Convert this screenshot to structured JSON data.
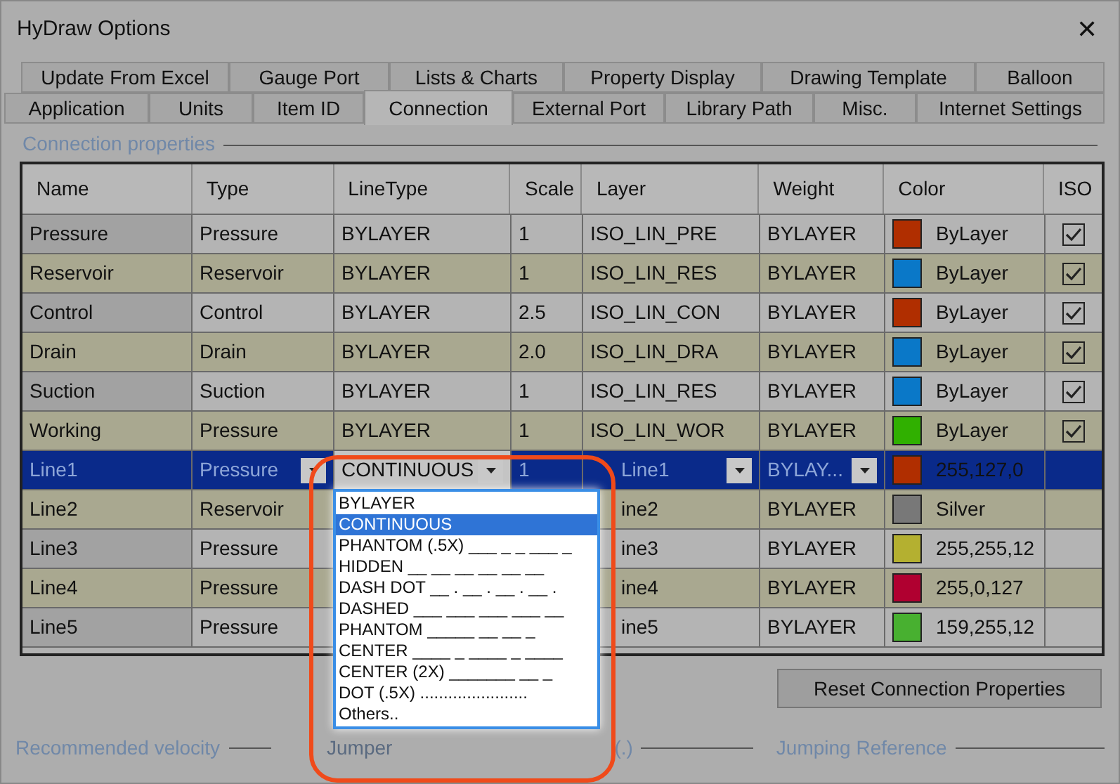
{
  "window": {
    "title": "HyDraw Options",
    "close": "✕"
  },
  "tab_rows": [
    [
      {
        "label": "Update From Excel",
        "selected": false
      },
      {
        "label": "Gauge Port",
        "selected": false
      },
      {
        "label": "Lists & Charts",
        "selected": false
      },
      {
        "label": "Property Display",
        "selected": false
      },
      {
        "label": "Drawing Template",
        "selected": false
      },
      {
        "label": "Balloon",
        "selected": false
      }
    ],
    [
      {
        "label": "Application",
        "selected": false
      },
      {
        "label": "Units",
        "selected": false
      },
      {
        "label": "Item ID",
        "selected": false
      },
      {
        "label": "Connection",
        "selected": true
      },
      {
        "label": "External Port",
        "selected": false
      },
      {
        "label": "Library Path",
        "selected": false
      },
      {
        "label": "Misc.",
        "selected": false
      },
      {
        "label": "Internet Settings",
        "selected": false
      }
    ]
  ],
  "group_title": "Connection properties",
  "table": {
    "columns": [
      "Name",
      "Type",
      "LineType",
      "Scale",
      "Layer",
      "Weight",
      "Color",
      "ISO"
    ],
    "rows": [
      {
        "name": "Pressure",
        "type": "Pressure",
        "linetype": "BYLAYER",
        "scale": "1",
        "layer": "ISO_LIN_PRE",
        "weight": "BYLAYER",
        "color": "#b02e00",
        "color_label": "ByLayer",
        "iso": true,
        "selected": false
      },
      {
        "name": "Reservoir",
        "type": "Reservoir",
        "linetype": "BYLAYER",
        "scale": "1",
        "layer": "ISO_LIN_RES",
        "weight": "BYLAYER",
        "color": "#0a78c8",
        "color_label": "ByLayer",
        "iso": true,
        "selected": false
      },
      {
        "name": "Control",
        "type": "Control",
        "linetype": "BYLAYER",
        "scale": "2.5",
        "layer": "ISO_LIN_CON",
        "weight": "BYLAYER",
        "color": "#b02e00",
        "color_label": "ByLayer",
        "iso": true,
        "selected": false
      },
      {
        "name": "Drain",
        "type": "Drain",
        "linetype": "BYLAYER",
        "scale": "2.0",
        "layer": "ISO_LIN_DRA",
        "weight": "BYLAYER",
        "color": "#0a78c8",
        "color_label": "ByLayer",
        "iso": true,
        "selected": false
      },
      {
        "name": "Suction",
        "type": "Suction",
        "linetype": "BYLAYER",
        "scale": "1",
        "layer": "ISO_LIN_RES",
        "weight": "BYLAYER",
        "color": "#0a78c8",
        "color_label": "ByLayer",
        "iso": true,
        "selected": false
      },
      {
        "name": "Working",
        "type": "Pressure",
        "linetype": "BYLAYER",
        "scale": "1",
        "layer": "ISO_LIN_WOR",
        "weight": "BYLAYER",
        "color": "#30b000",
        "color_label": "ByLayer",
        "iso": true,
        "selected": false
      },
      {
        "name": "Line1",
        "type": "Pressure",
        "linetype": "CONTINUOUS",
        "scale": "1",
        "layer": "Line1",
        "weight": "BYLAY...",
        "color": "#b02e00",
        "color_label": "255,127,0",
        "selected": true
      },
      {
        "name": "Line2",
        "type": "Reservoir",
        "layer": "ine2",
        "weight": "BYLAYER",
        "color": "#787878",
        "color_label": "Silver",
        "selected": false
      },
      {
        "name": "Line3",
        "type": "Pressure",
        "layer": "ine3",
        "weight": "BYLAYER",
        "color": "#b4b030",
        "color_label": "255,255,12",
        "selected": false
      },
      {
        "name": "Line4",
        "type": "Pressure",
        "layer": "ine4",
        "weight": "BYLAYER",
        "color": "#b00030",
        "color_label": "255,0,127",
        "selected": false
      },
      {
        "name": "Line5",
        "type": "Pressure",
        "layer": "ine5",
        "weight": "BYLAYER",
        "color": "#48b030",
        "color_label": "159,255,12",
        "selected": false
      }
    ]
  },
  "linetype_list": [
    {
      "label": "BYLAYER",
      "selected": false
    },
    {
      "label": "CONTINUOUS",
      "selected": true
    },
    {
      "label": "PHANTOM (.5X) ___ _ _ ___ _",
      "selected": false
    },
    {
      "label": "HIDDEN __ __ __ __ __ __",
      "selected": false
    },
    {
      "label": "DASH DOT __ . __ . __ . __ .",
      "selected": false
    },
    {
      "label": "DASHED ___ ___ ___ ___ __",
      "selected": false
    },
    {
      "label": "PHANTOM _____  __  __  _",
      "selected": false
    },
    {
      "label": "CENTER ____ _ ____ _ ____",
      "selected": false
    },
    {
      "label": "CENTER (2X) _______  __  _",
      "selected": false
    },
    {
      "label": "DOT (.5X) .......................",
      "selected": false
    },
    {
      "label": "Others..",
      "selected": false
    }
  ],
  "reset_button": "Reset Connection Properties",
  "bottom_groups": [
    "Recommended velocity",
    "Jumper",
    "(.)",
    "Jumping Reference"
  ]
}
